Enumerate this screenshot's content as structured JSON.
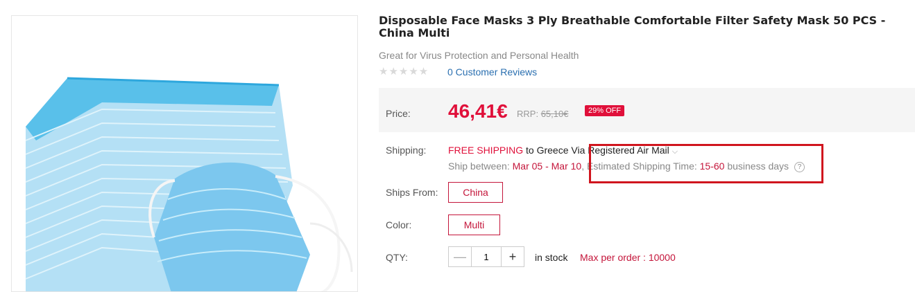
{
  "product": {
    "title": "Disposable Face Masks 3 Ply Breathable Comfortable Filter Safety Mask 50 PCS - China Multi",
    "subtitle": "Great for Virus Protection and Personal Health",
    "rating_stars": "★★★★★",
    "reviews_link": "0 Customer Reviews"
  },
  "price": {
    "label": "Price:",
    "current": "46,41€",
    "rrp_label": "RRP:",
    "rrp_value": "65,10€",
    "discount_badge": "29% OFF"
  },
  "shipping": {
    "label": "Shipping:",
    "free_text": "FREE SHIPPING",
    "destination_text": " to Greece Via Registered Air Mail",
    "ship_between_label": "Ship between: ",
    "ship_between_dates": "Mar 05 - Mar 10",
    "estimated_label": ", Estimated Shipping Time: ",
    "estimated_range": "15-60",
    "estimated_unit": " business days",
    "help_symbol": "?"
  },
  "ships_from": {
    "label": "Ships From:",
    "selected": "China"
  },
  "color_option": {
    "label": "Color:",
    "selected": "Multi"
  },
  "qty": {
    "label": "QTY:",
    "value": "1",
    "minus_symbol": "—",
    "plus_symbol": "+",
    "stock_text": "in stock",
    "max_text": "Max per order : 10000"
  },
  "colors": {
    "accent_red": "#e0103a",
    "link_blue": "#2a6fb0",
    "highlight_box": "#d0151e",
    "mask_blue": "#8ed0f0"
  }
}
